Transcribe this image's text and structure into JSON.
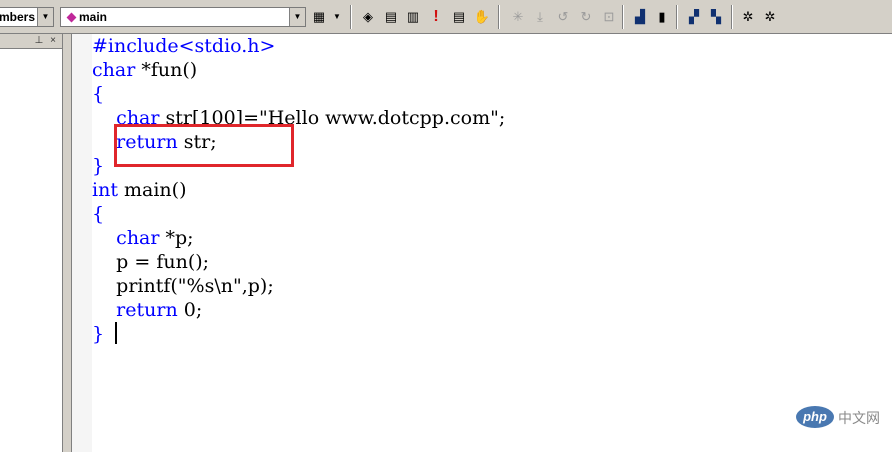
{
  "toolbar": {
    "members_combo_value": "mbers",
    "function_combo_value": "main"
  },
  "editor": {
    "lines": [
      [
        {
          "t": "#include<stdio.h>",
          "c": "kw"
        }
      ],
      [
        {
          "t": "char",
          "c": "kw"
        },
        {
          "t": " *fun()"
        }
      ],
      [
        {
          "t": "{",
          "c": "kw"
        }
      ],
      [
        {
          "t": "    "
        },
        {
          "t": "char",
          "c": "kw"
        },
        {
          "t": " str[100]=\"Hello www.dotcpp.com\";"
        }
      ],
      [
        {
          "t": "    "
        },
        {
          "t": "return",
          "c": "kw"
        },
        {
          "t": " str;"
        }
      ],
      [
        {
          "t": "}",
          "c": "kw"
        }
      ],
      [
        {
          "t": "int",
          "c": "kw"
        },
        {
          "t": " main()"
        }
      ],
      [
        {
          "t": "{",
          "c": "kw"
        }
      ],
      [
        {
          "t": "    "
        },
        {
          "t": "char",
          "c": "kw"
        },
        {
          "t": " *p;"
        }
      ],
      [
        {
          "t": "    p = fun();"
        }
      ],
      [
        {
          "t": "    printf(\"%s\\n\",p);"
        }
      ],
      [
        {
          "t": "    "
        },
        {
          "t": "return",
          "c": "kw"
        },
        {
          "t": " 0;"
        }
      ],
      [
        {
          "t": "}",
          "c": "kw"
        }
      ]
    ],
    "keyword_color": "#0000ff",
    "annotation_box_color": "#e0262b"
  },
  "watermark": {
    "logo_text": "php",
    "text": "中文网"
  }
}
